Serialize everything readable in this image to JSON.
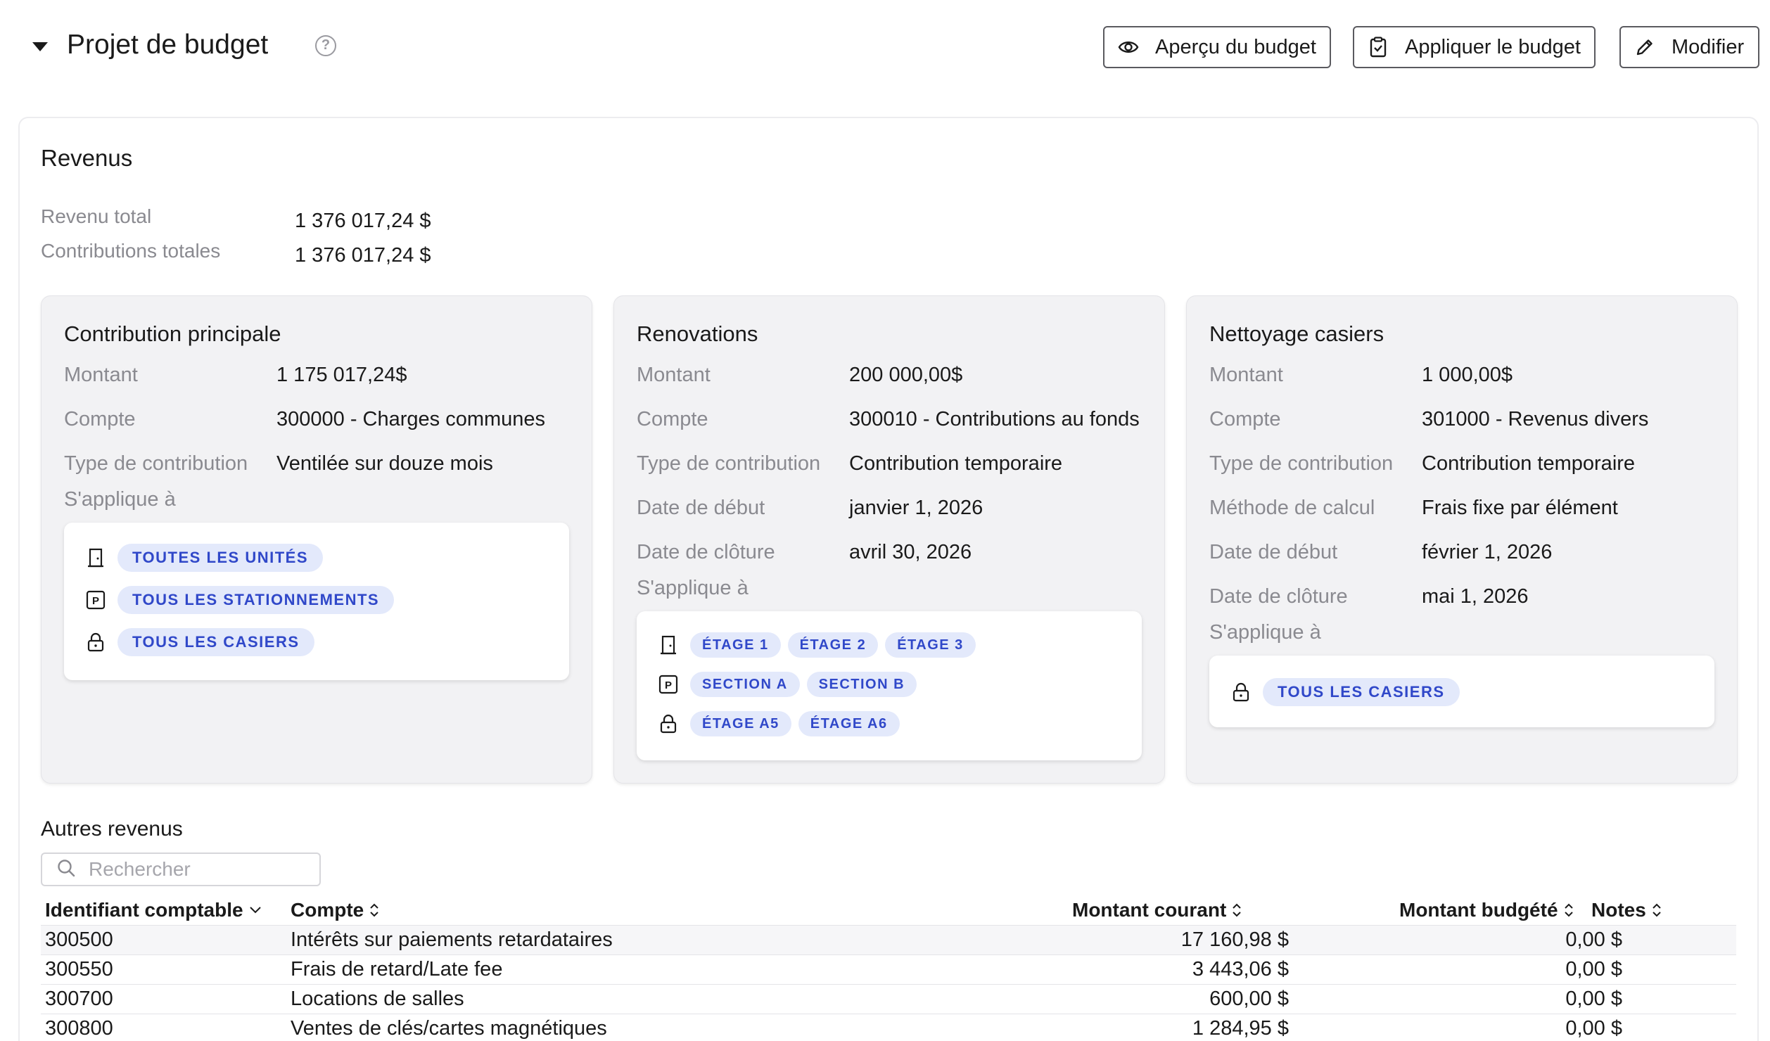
{
  "header": {
    "title": "Projet de budget",
    "buttons": {
      "preview": "Aperçu du budget",
      "apply": "Appliquer le budget",
      "edit": "Modifier"
    }
  },
  "revenus": {
    "title": "Revenus",
    "summary": [
      {
        "label": "Revenu total",
        "value": "1 376 017,24 $"
      },
      {
        "label": "Contributions totales",
        "value": "1 376 017,24 $"
      }
    ]
  },
  "contributions": [
    {
      "title": "Contribution principale",
      "fields": [
        {
          "label": "Montant",
          "value": "1 175 017,24$"
        },
        {
          "label": "Compte",
          "value": "300000 - Charges communes"
        },
        {
          "label": "Type de contribution",
          "value": "Ventilée sur douze mois"
        }
      ],
      "applies_label": "S'applique à",
      "applies": [
        {
          "icon": "door-icon",
          "tags": [
            "TOUTES LES UNITÉS"
          ]
        },
        {
          "icon": "parking-icon",
          "tags": [
            "TOUS LES STATIONNEMENTS"
          ]
        },
        {
          "icon": "lock-icon",
          "tags": [
            "TOUS LES CASIERS"
          ]
        }
      ]
    },
    {
      "title": "Renovations",
      "fields": [
        {
          "label": "Montant",
          "value": "200 000,00$"
        },
        {
          "label": "Compte",
          "value": "300010 - Contributions au fonds"
        },
        {
          "label": "Type de contribution",
          "value": "Contribution temporaire"
        },
        {
          "label": "Date de début",
          "value": "janvier 1, 2026"
        },
        {
          "label": "Date de clôture",
          "value": "avril 30, 2026"
        }
      ],
      "applies_label": "S'applique à",
      "applies": [
        {
          "icon": "door-icon",
          "tags": [
            "ÉTAGE 1",
            "ÉTAGE 2",
            "ÉTAGE 3"
          ]
        },
        {
          "icon": "parking-icon",
          "tags": [
            "SECTION A",
            "SECTION B"
          ]
        },
        {
          "icon": "lock-icon",
          "tags": [
            "ÉTAGE A5",
            "ÉTAGE A6"
          ]
        }
      ]
    },
    {
      "title": "Nettoyage casiers",
      "fields": [
        {
          "label": "Montant",
          "value": "1 000,00$"
        },
        {
          "label": "Compte",
          "value": "301000 - Revenus divers"
        },
        {
          "label": "Type de contribution",
          "value": "Contribution temporaire"
        },
        {
          "label": "Méthode de calcul",
          "value": "Frais fixe par élément"
        },
        {
          "label": "Date de début",
          "value": "février 1, 2026"
        },
        {
          "label": "Date de clôture",
          "value": "mai 1, 2026"
        }
      ],
      "applies_label": "S'applique à",
      "applies": [
        {
          "icon": "lock-icon",
          "tags": [
            "TOUS LES CASIERS"
          ]
        }
      ]
    }
  ],
  "other": {
    "title": "Autres revenus",
    "search_placeholder": "Rechercher",
    "columns": [
      "Identifiant comptable",
      "Compte",
      "Montant courant",
      "Montant budgété",
      "Notes"
    ],
    "rows": [
      {
        "id": "300500",
        "account": "Intérêts sur paiements retardataires",
        "current": "17 160,98 $",
        "budgeted": "0,00 $",
        "notes": ""
      },
      {
        "id": "300550",
        "account": "Frais de retard/Late fee",
        "current": "3 443,06 $",
        "budgeted": "0,00 $",
        "notes": ""
      },
      {
        "id": "300700",
        "account": "Locations de salles",
        "current": "600,00 $",
        "budgeted": "0,00 $",
        "notes": ""
      },
      {
        "id": "300800",
        "account": "Ventes de clés/cartes magnétiques",
        "current": "1 284,95 $",
        "budgeted": "0,00 $",
        "notes": ""
      }
    ]
  }
}
